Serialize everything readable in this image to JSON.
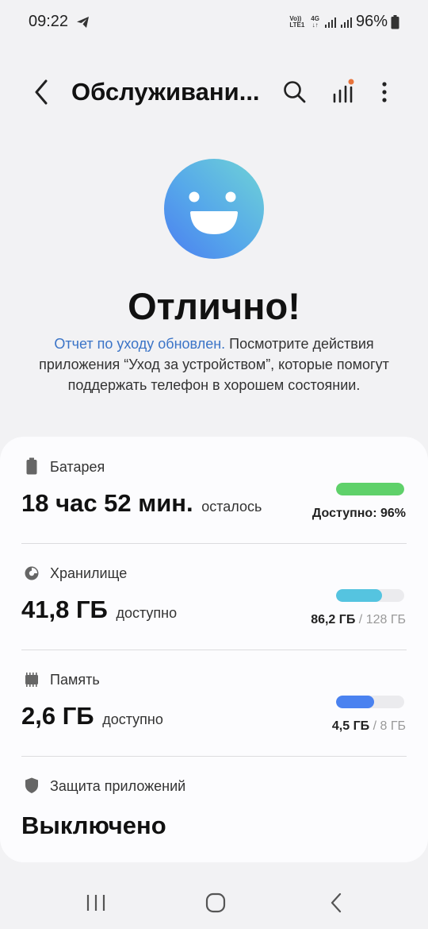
{
  "status_bar": {
    "time": "09:22",
    "volte_top": "Vo))",
    "volte_bottom": "LTE1",
    "net_type": "4G",
    "battery_percent": "96%"
  },
  "header": {
    "title": "Обслуживани..."
  },
  "hero": {
    "headline": "Отлично!",
    "description_link": "Отчет по уходу обновлен.",
    "description_text": " Посмотрите действия приложения “Уход за устройством”, которые помогут поддержать телефон в хорошем состоянии."
  },
  "sections": {
    "battery": {
      "label": "Батарея",
      "value": "18 час 52 мин.",
      "suffix": "осталось",
      "caption": "Доступно: 96%",
      "fill_fraction": 1.0,
      "color": "#5fd16a"
    },
    "storage": {
      "label": "Хранилище",
      "value": "41,8 ГБ",
      "suffix": "доступно",
      "used": "86,2 ГБ",
      "total": "/ 128 ГБ",
      "fill_fraction": 0.67,
      "color": "#55c4e0"
    },
    "memory": {
      "label": "Память",
      "value": "2,6 ГБ",
      "suffix": "доступно",
      "used": "4,5 ГБ",
      "total": "/ 8 ГБ",
      "fill_fraction": 0.56,
      "color": "#4a82f0"
    },
    "app_protection": {
      "label": "Защита приложений",
      "value": "Выключено"
    }
  },
  "icons": {
    "back": "chevron-left-icon",
    "search": "search-icon",
    "signal": "signal-bars-icon",
    "more": "more-vertical-icon"
  },
  "colors": {
    "accent_link": "#3b74c7",
    "notification_dot": "#e8743b"
  }
}
